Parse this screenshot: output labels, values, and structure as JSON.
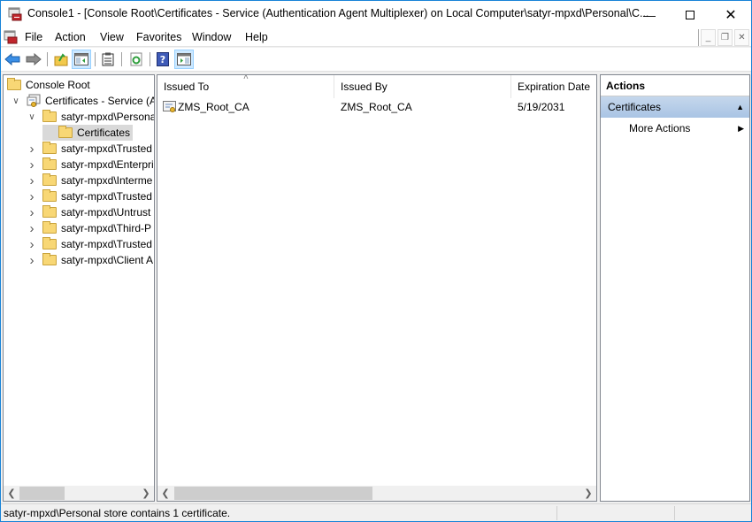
{
  "window": {
    "title": "Console1 - [Console Root\\Certificates - Service (Authentication Agent Multiplexer) on Local Computer\\satyr-mpxd\\Personal\\C...",
    "minimize_icon": "minimize-icon",
    "maximize_icon": "maximize-icon",
    "close_icon": "close-icon"
  },
  "menubar": {
    "items": [
      "File",
      "Action",
      "View",
      "Favorites",
      "Window",
      "Help"
    ]
  },
  "toolbar": {
    "buttons": [
      "back-icon",
      "forward-icon",
      "up-folder-icon",
      "show-hide-console-tree-icon",
      "properties-icon",
      "refresh-icon",
      "help-icon",
      "show-hide-action-pane-icon"
    ]
  },
  "tree": {
    "items": [
      {
        "label": "Console Root",
        "level": 0,
        "expander": ""
      },
      {
        "label": "Certificates - Service (Au",
        "level": 1,
        "expander": "expanded"
      },
      {
        "label": "satyr-mpxd\\Persona",
        "level": 2,
        "expander": "expanded"
      },
      {
        "label": "Certificates",
        "level": 3,
        "expander": "",
        "selected": true
      },
      {
        "label": "satyr-mpxd\\Trusted",
        "level": 2,
        "expander": "collapsed"
      },
      {
        "label": "satyr-mpxd\\Enterpri",
        "level": 2,
        "expander": "collapsed"
      },
      {
        "label": "satyr-mpxd\\Interme",
        "level": 2,
        "expander": "collapsed"
      },
      {
        "label": "satyr-mpxd\\Trusted",
        "level": 2,
        "expander": "collapsed"
      },
      {
        "label": "satyr-mpxd\\Untrust",
        "level": 2,
        "expander": "collapsed"
      },
      {
        "label": "satyr-mpxd\\Third-P",
        "level": 2,
        "expander": "collapsed"
      },
      {
        "label": "satyr-mpxd\\Trusted",
        "level": 2,
        "expander": "collapsed"
      },
      {
        "label": "satyr-mpxd\\Client A",
        "level": 2,
        "expander": "collapsed"
      }
    ]
  },
  "list": {
    "columns": [
      "Issued To",
      "Issued By",
      "Expiration Date"
    ],
    "sort_column": "Issued To",
    "rows": [
      {
        "issued_to": "ZMS_Root_CA",
        "issued_by": "ZMS_Root_CA",
        "expiration": "5/19/2031"
      }
    ]
  },
  "actions": {
    "header": "Actions",
    "section": "Certificates",
    "items": [
      "More Actions"
    ]
  },
  "status": {
    "text": "satyr-mpxd\\Personal store contains 1 certificate."
  }
}
